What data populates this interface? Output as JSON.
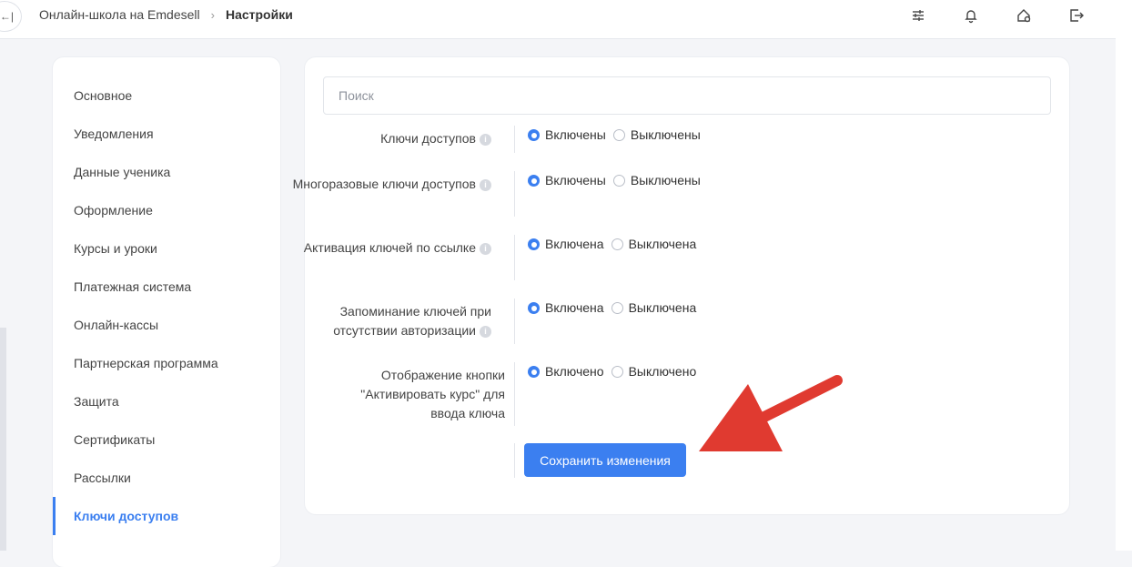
{
  "header": {
    "breadcrumb": [
      "Онлайн-школа на Emdesell",
      "Настройки"
    ],
    "collapse_label": "←|",
    "icons": [
      "sliders-icon",
      "bell-icon",
      "home-settings-icon",
      "logout-icon"
    ]
  },
  "sidebar": {
    "items": [
      {
        "label": "Основное"
      },
      {
        "label": "Уведомления"
      },
      {
        "label": "Данные ученика"
      },
      {
        "label": "Оформление"
      },
      {
        "label": "Курсы и уроки"
      },
      {
        "label": "Платежная система"
      },
      {
        "label": "Онлайн-кассы"
      },
      {
        "label": "Партнерская программа"
      },
      {
        "label": "Защита"
      },
      {
        "label": "Сертификаты"
      },
      {
        "label": "Рассылки"
      },
      {
        "label": "Ключи доступов",
        "active": true
      }
    ]
  },
  "search": {
    "placeholder": "Поиск",
    "value": ""
  },
  "settings": [
    {
      "label": "Ключи доступов",
      "on": "Включены",
      "off": "Выключены",
      "selected": "on"
    },
    {
      "label": "Многоразовые ключи доступов",
      "on": "Включены",
      "off": "Выключены",
      "selected": "on"
    },
    {
      "label": "Активация ключей по ссылке",
      "on": "Включена",
      "off": "Выключена",
      "selected": "on"
    },
    {
      "label": "Запоминание ключей при отсутствии авторизации",
      "on": "Включена",
      "off": "Выключена",
      "selected": "on"
    },
    {
      "label": "Отображение кнопки \"Активировать курс\" для ввода ключа",
      "on": "Включено",
      "off": "Выключено",
      "selected": "on"
    }
  ],
  "save_label": "Сохранить изменения",
  "colors": {
    "accent": "#3b7ff0",
    "arrow": "#e03a30"
  }
}
